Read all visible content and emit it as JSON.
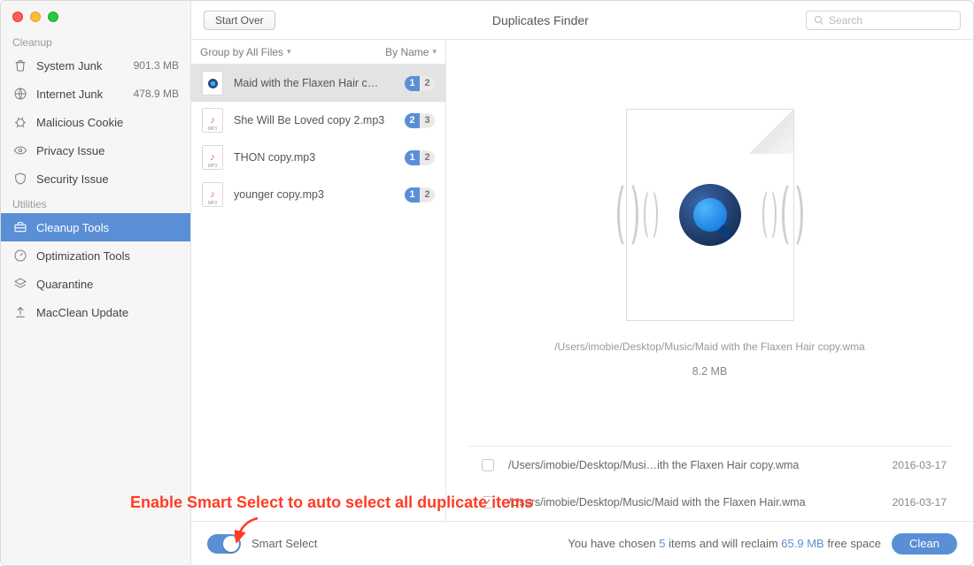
{
  "window": {
    "title": "Duplicates Finder"
  },
  "toolbar": {
    "start_over": "Start Over",
    "search_placeholder": "Search"
  },
  "sidebar": {
    "sections": [
      {
        "label": "Cleanup",
        "items": [
          {
            "icon": "trash-icon",
            "label": "System Junk",
            "size": "901.3 MB"
          },
          {
            "icon": "globe-icon",
            "label": "Internet Junk",
            "size": "478.9 MB"
          },
          {
            "icon": "bug-icon",
            "label": "Malicious Cookie",
            "size": ""
          },
          {
            "icon": "eye-icon",
            "label": "Privacy Issue",
            "size": ""
          },
          {
            "icon": "shield-icon",
            "label": "Security Issue",
            "size": ""
          }
        ]
      },
      {
        "label": "Utilities",
        "items": [
          {
            "icon": "toolbox-icon",
            "label": "Cleanup Tools",
            "size": "",
            "active": true
          },
          {
            "icon": "gauge-icon",
            "label": "Optimization Tools",
            "size": ""
          },
          {
            "icon": "layers-icon",
            "label": "Quarantine",
            "size": ""
          },
          {
            "icon": "upload-icon",
            "label": "MacClean Update",
            "size": ""
          }
        ]
      }
    ]
  },
  "list": {
    "group_label": "Group by All Files",
    "sort_label": "By Name",
    "rows": [
      {
        "type": "wma",
        "name": "Maid with the Flaxen Hair c…",
        "selected": 1,
        "total": 2,
        "active": true
      },
      {
        "type": "mp3",
        "name": "She Will Be Loved copy 2.mp3",
        "selected": 2,
        "total": 3
      },
      {
        "type": "mp3",
        "name": "THON copy.mp3",
        "selected": 1,
        "total": 2
      },
      {
        "type": "mp3",
        "name": "younger copy.mp3",
        "selected": 1,
        "total": 2
      }
    ]
  },
  "detail": {
    "path": "/Users/imobie/Desktop/Music/Maid with the Flaxen Hair copy.wma",
    "size": "8.2 MB",
    "duplicates": [
      {
        "checked": false,
        "path": "/Users/imobie/Desktop/Musi…ith the Flaxen Hair copy.wma",
        "date": "2016-03-17"
      },
      {
        "checked": true,
        "path": "/Users/imobie/Desktop/Music/Maid with the Flaxen Hair.wma",
        "date": "2016-03-17"
      }
    ]
  },
  "footer": {
    "smart_select": "Smart Select",
    "msg_pre": "You have chosen ",
    "msg_count": "5",
    "msg_mid": " items and will reclaim ",
    "msg_size": "65.9 MB",
    "msg_post": " free space",
    "clean": "Clean"
  },
  "annotation": "Enable Smart Select to auto select all duplicate items"
}
